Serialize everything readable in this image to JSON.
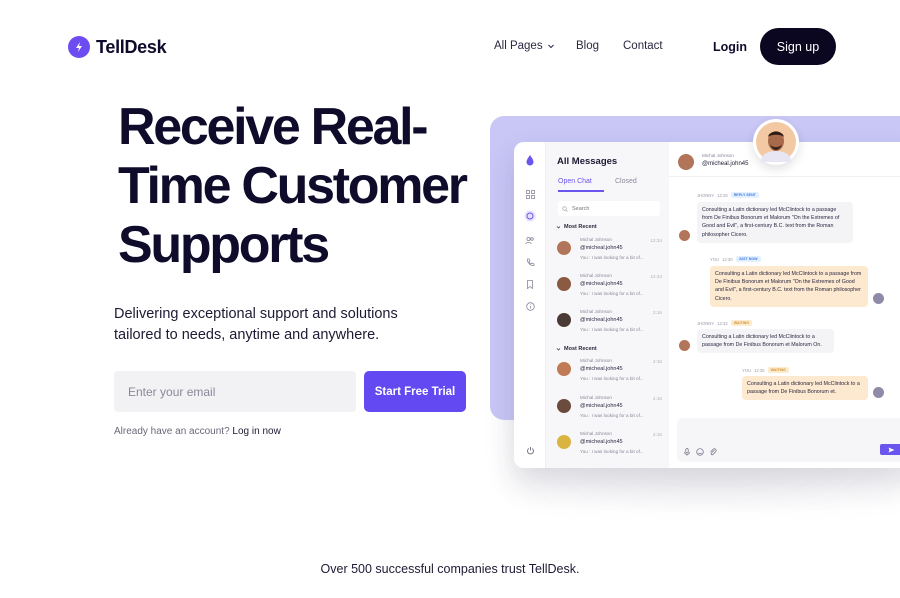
{
  "brand": {
    "name": "TellDesk",
    "accent": "#6349f1"
  },
  "nav": {
    "links": [
      "All Pages",
      "Blog",
      "Contact"
    ],
    "login": "Login",
    "signup": "Sign up"
  },
  "hero": {
    "title_lines": [
      "Receive Real-",
      "Time Customer",
      "Supports"
    ],
    "subtitle_lines": [
      "Delivering exceptional support and solutions",
      "tailored to needs, anytime and anywhere."
    ],
    "email_placeholder": "Enter your email",
    "cta": "Start Free Trial",
    "already_text": "Already have an account?",
    "login_now": "Log in now"
  },
  "trust_text": "Over 500 successful companies trust TellDesk.",
  "mockup": {
    "list_title": "All Messages",
    "tabs": [
      "Open Chat",
      "Closed"
    ],
    "search_placeholder": "Search",
    "section1": "Most Recent",
    "section2": "Most Recent",
    "chats": [
      {
        "name": "Michal Johnson",
        "handle": "@micheal.john45",
        "msg": "You : I was looking for a bit of...",
        "time": "12:34"
      },
      {
        "name": "Michal Johnson",
        "handle": "@micheal.john45",
        "msg": "You : I was looking for a bit of...",
        "time": "12:34"
      },
      {
        "name": "Michal Johnson",
        "handle": "@micheal.john45",
        "msg": "You : I was looking for a bit of...",
        "time": "2:16"
      },
      {
        "name": "Michal Johnson",
        "handle": "@micheal.john45",
        "msg": "You : I was looking for a bit of...",
        "time": "2:16"
      },
      {
        "name": "Michal Johnson",
        "handle": "@micheal.john45",
        "msg": "You : I was looking for a bit of...",
        "time": "2:16"
      },
      {
        "name": "Michal Johnson",
        "handle": "@micheal.john45",
        "msg": "You : I was looking for a bit of...",
        "time": "2:16"
      }
    ],
    "chat_header": {
      "name": "Michal Johnson",
      "handle": "@micheal.john45"
    },
    "messages": [
      {
        "who": "JHONNY",
        "time": "12:25",
        "badge": "REPLY SENT",
        "text": "Consulting a Latin dictionary led McClintock to a passage from De Finibus Bonorum et Malorum \"On the Extremes of Good and Evil\", a first-century B.C. text from the Roman philosopher Cicero."
      },
      {
        "who": "YOU",
        "time": "12:30",
        "badge": "JUST NOW",
        "text": "Consulting a Latin dictionary led McClintock to a passage from De Finibus Bonorum et Malorum \"On the Extremes of Good and Evil\", a first-century B.C. text from the Roman philosopher Cicero."
      },
      {
        "who": "JHONNY",
        "time": "12:32",
        "badge": "WAITING",
        "text": "Consulting a Latin dictionary led McClintock to a passage from De Finibus Bonorum et Malorum On."
      },
      {
        "who": "YOU",
        "time": "12:35",
        "badge": "WAITING",
        "text": "Consulting a Latin dictionary led McClintock to a passage from De Finibus Bonorum et."
      }
    ],
    "colors": {
      "panel_bg": "#c9c7f6",
      "outgoing": "#fde9cf",
      "incoming": "#f4f4f7"
    }
  }
}
